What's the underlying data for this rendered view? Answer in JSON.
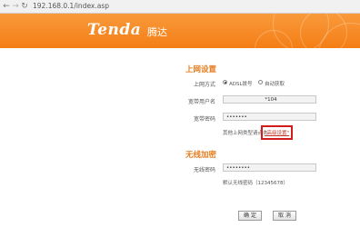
{
  "browser": {
    "url": "192.168.0.1/index.asp"
  },
  "header": {
    "logo_text": "Tenda",
    "logo_cn": "腾达",
    "background_color": "#f48a26"
  },
  "internet_section": {
    "title": "上网设置",
    "mode_label": "上网方式",
    "mode_options": [
      {
        "label": "ADSL拨号",
        "selected": true
      },
      {
        "label": "自动获取",
        "selected": false
      }
    ],
    "username_label": "宽带用户名",
    "username_value": "*104",
    "password_label": "宽带密码",
    "password_value": "•••••••",
    "other_mode_text": "其他上网类型请点击",
    "advanced_link": "\"高级设置\""
  },
  "wireless_section": {
    "title": "无线加密",
    "password_label": "无线密码",
    "password_value": "••••••••",
    "default_hint": "默认无线密码（12345678）"
  },
  "buttons": {
    "confirm": "确 定",
    "cancel": "取 消"
  }
}
